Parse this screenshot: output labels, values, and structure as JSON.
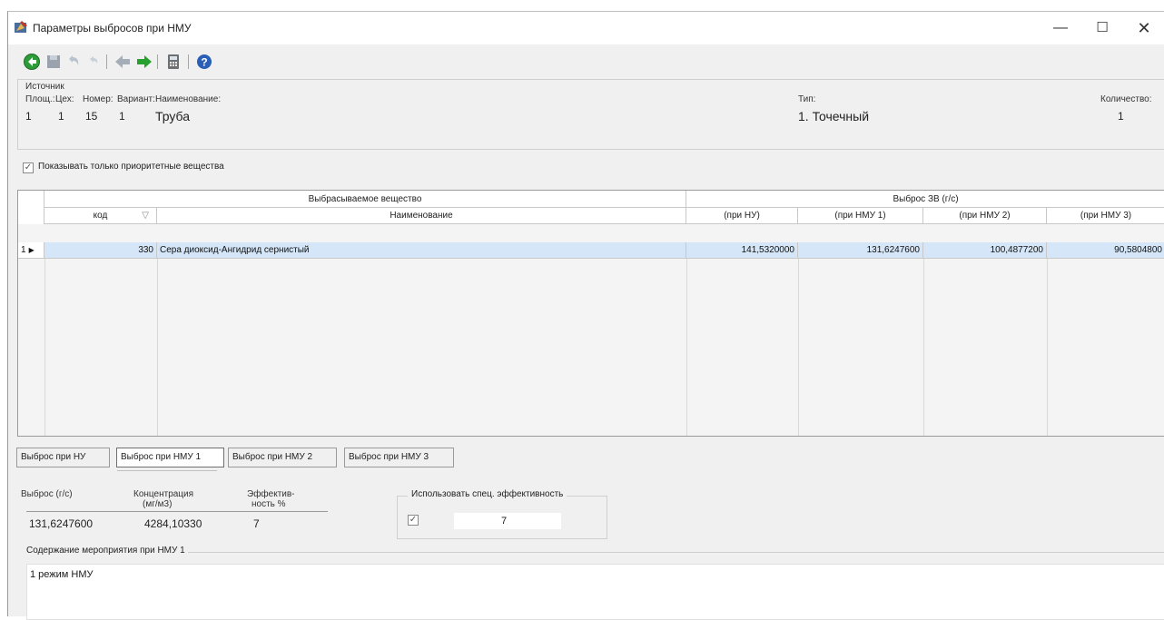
{
  "window": {
    "title": "Параметры выбросов при НМУ",
    "buttons": {
      "minimize": "—",
      "maximize": "☐",
      "close": "✕"
    }
  },
  "toolbar": {
    "icons": [
      "go-icon",
      "save-icon",
      "undo-icon",
      "redo-icon",
      "arrow-left-icon",
      "arrow-right-icon",
      "calculator-icon",
      "help-icon"
    ]
  },
  "source": {
    "group_label": "Источник",
    "labels": {
      "area": "Площ.:",
      "workshop": "Цех:",
      "number": "Номер:",
      "variant": "Вариант:",
      "name": "Наименование:",
      "type": "Тип:",
      "count": "Количество:"
    },
    "values": {
      "area": "1",
      "workshop": "1",
      "number": "15",
      "variant": "1",
      "name": "Труба",
      "type": "1. Точечный",
      "count": "1"
    }
  },
  "priority_filter": {
    "label": "Показывать только приоритетные вещества",
    "checked": true
  },
  "grid": {
    "group_header_substance": "Выбрасываемое вещество",
    "group_header_emission": "Выброс ЗВ (г/с)",
    "columns": {
      "code": "код",
      "name": "Наименование",
      "nu": "(при НУ)",
      "nmu1": "(при НМУ 1)",
      "nmu2": "(при НМУ 2)",
      "nmu3": "(при НМУ 3)"
    },
    "rows": [
      {
        "index": "1",
        "code": "330",
        "name": "Сера диоксид-Ангидрид сернистый",
        "nu": "141,5320000",
        "nmu1": "131,6247600",
        "nmu2": "100,4877200",
        "nmu3": "90,5804800"
      }
    ]
  },
  "tabs": [
    {
      "label": "Выброс при НУ",
      "active": false
    },
    {
      "label": "Выброс при НМУ 1",
      "active": true
    },
    {
      "label": "Выброс при НМУ 2",
      "active": false
    },
    {
      "label": "Выброс при НМУ 3",
      "active": false
    }
  ],
  "nmu_details": {
    "emission_label": "Выброс (г/с)",
    "concentration_label_1": "Концентрация",
    "concentration_label_2": "(мг/м3)",
    "efficiency_label_1": "Эффектив-",
    "efficiency_label_2": "ность %",
    "emission_value": "131,6247600",
    "concentration_value": "4284,10330",
    "efficiency_value": "7",
    "special_efficiency_title": "Использовать спец. эффективность",
    "special_efficiency_checked": true,
    "special_efficiency_value": "7",
    "measures_label": "Содержание мероприятия при НМУ 1",
    "measures_text": "1 режим НМУ"
  }
}
